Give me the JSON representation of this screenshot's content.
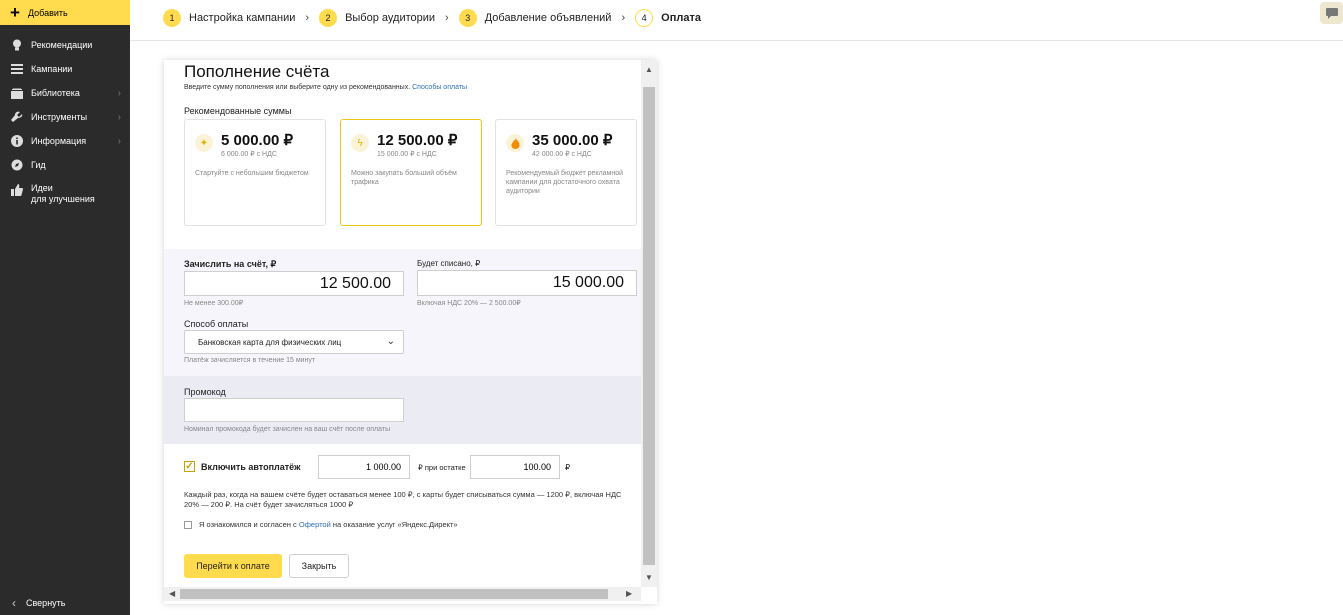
{
  "sidebar": {
    "add_label": "Добавить",
    "items": [
      {
        "label": "Рекомендации",
        "icon": "lightbulb-icon"
      },
      {
        "label": "Кампании",
        "icon": "menu-icon"
      },
      {
        "label": "Библиотека",
        "icon": "library-icon"
      },
      {
        "label": "Инструменты",
        "icon": "wrench-icon"
      },
      {
        "label": "Информация",
        "icon": "info-icon"
      },
      {
        "label": "Гид",
        "icon": "guide-icon"
      }
    ],
    "ideas_line1": "Идеи",
    "ideas_line2": "для улучшения",
    "collapse_label": "Свернуть"
  },
  "steps": [
    {
      "num": "1",
      "label": "Настройка кампании"
    },
    {
      "num": "2",
      "label": "Выбор аудитории"
    },
    {
      "num": "3",
      "label": "Добавление объявлений"
    },
    {
      "num": "4",
      "label": "Оплата"
    }
  ],
  "dialog": {
    "title": "Пополнение счёта",
    "subtitle": "Введите сумму пополнения или выберите одну из рекомендованных.",
    "subtitle_link": "Способы оплаты",
    "recommended_label": "Рекомендованные суммы",
    "cards": [
      {
        "amount": "5 000.00 ₽",
        "vat": "6 000.00 ₽ с НДС",
        "desc": "Стартуйте с небольшим бюджетом",
        "icon": "sparkle-icon"
      },
      {
        "amount": "12 500.00 ₽",
        "vat": "15 000.00 ₽ с НДС",
        "desc": "Можно закупать больший объём трафика",
        "icon": "lightning-icon"
      },
      {
        "amount": "35 000.00 ₽",
        "vat": "42 000.00 ₽ с НДС",
        "desc": "Рекомендуемый бюджет рекламной кампании для достаточного охвата аудитории",
        "icon": "fire-icon"
      }
    ],
    "credit_label": "Зачислить на счёт, ₽",
    "credit_value": "12 500.00",
    "credit_hint": "Не менее 300.00₽",
    "debit_label": "Будет списано, ₽",
    "debit_value": "15 000.00",
    "debit_hint": "Включая НДС 20% — 2 500.00₽",
    "payment_method_label": "Способ оплаты",
    "payment_method_value": "Банковская карта для физических лиц",
    "payment_method_hint": "Платёж зачисляется в течение 15 минут",
    "promo_label": "Промокод",
    "promo_value": "",
    "promo_hint": "Номинал промокода будет зачислен на ваш счёт после оплаты",
    "autopay_label": "Включить автоплатёж",
    "autopay_amount": "1 000.00",
    "autopay_mid": "₽ при остатке",
    "autopay_threshold": "100.00",
    "autopay_currency": "₽",
    "autopay_desc": "Каждый раз, когда на вашем счёте будет оставаться менее 100 ₽, с карты будет списываться сумма — 1200 ₽, включая НДС 20% — 200 ₽. На счёт будет зачисляться 1000 ₽",
    "agree_prefix": "Я ознакомился и согласен с",
    "agree_link": "Офертой",
    "agree_suffix": "на оказание услуг «Яндекс.Директ»",
    "pay_button": "Перейти к оплате",
    "close_button": "Закрыть"
  },
  "colors": {
    "accent": "#ffdb4d",
    "sidebar_bg": "#2b2b2b",
    "link": "#2f6fb5"
  }
}
